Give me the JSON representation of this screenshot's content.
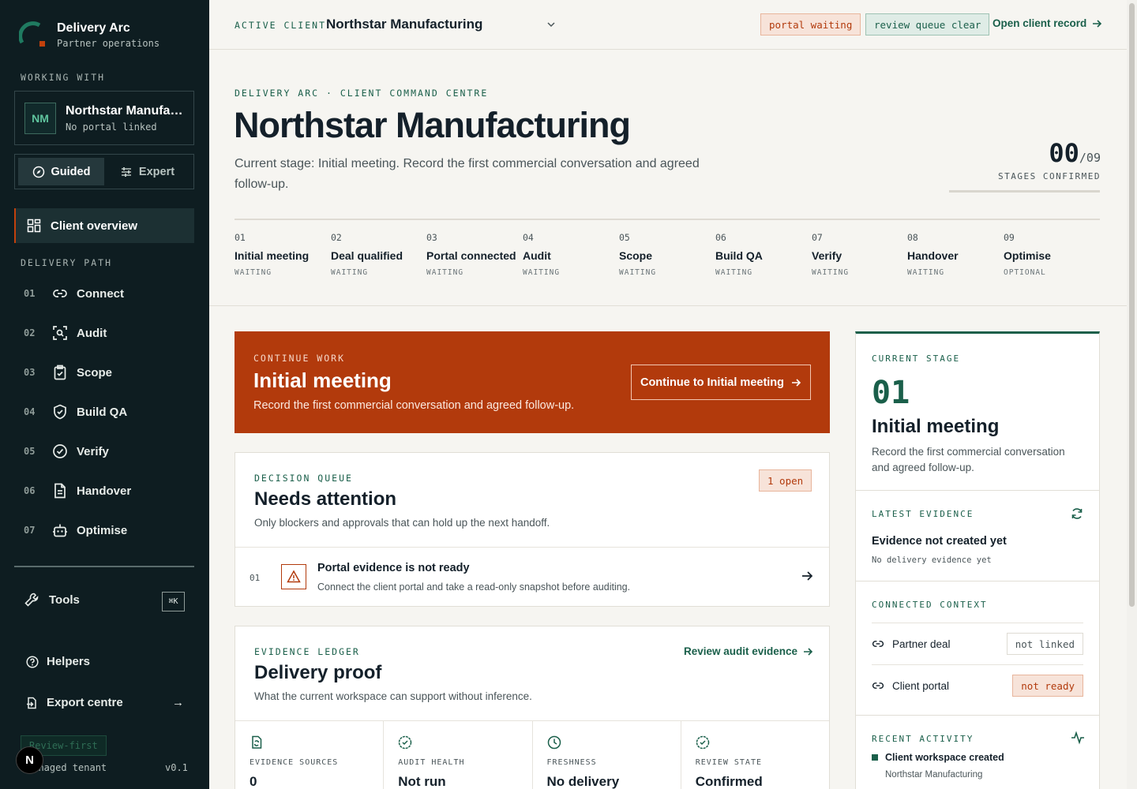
{
  "brand": {
    "name": "Delivery Arc",
    "subtitle": "Partner operations"
  },
  "sidebar": {
    "working_with_label": "WORKING WITH",
    "client": {
      "initials": "NM",
      "name": "Northstar Manufacturing",
      "status": "No portal linked"
    },
    "modes": [
      {
        "label": "Guided",
        "active": true
      },
      {
        "label": "Expert",
        "active": false
      }
    ],
    "overview": "Client overview",
    "delivery_path_label": "DELIVERY PATH",
    "nav": [
      {
        "num": "01",
        "label": "Connect",
        "icon": "link-icon"
      },
      {
        "num": "02",
        "label": "Audit",
        "icon": "scan-icon"
      },
      {
        "num": "03",
        "label": "Scope",
        "icon": "clipboard-icon"
      },
      {
        "num": "04",
        "label": "Build QA",
        "icon": "shield-icon"
      },
      {
        "num": "05",
        "label": "Verify",
        "icon": "check-circle-icon"
      },
      {
        "num": "06",
        "label": "Handover",
        "icon": "document-icon"
      },
      {
        "num": "07",
        "label": "Optimise",
        "icon": "bot-icon"
      }
    ],
    "tools": "Tools",
    "shortcut": "⌘K",
    "helpers": "Helpers",
    "export": "Export centre",
    "review_badge": "Review-first",
    "tenant": "Managed tenant",
    "version": "v0.1"
  },
  "topbar": {
    "label": "ACTIVE CLIENT",
    "client": "Northstar Manufacturing",
    "chip_portal": "portal waiting",
    "chip_review": "review queue clear",
    "link": "Open client record"
  },
  "hero": {
    "eyebrow": "DELIVERY ARC · CLIENT COMMAND CENTRE",
    "title": "Northstar Manufacturing",
    "desc": "Current stage: Initial meeting. Record the first commercial conversation and agreed follow-up.",
    "counter": "00",
    "counter_of": "/09",
    "counter_label": "STAGES CONFIRMED",
    "progress": 0
  },
  "stages": [
    {
      "num": "01",
      "name": "Initial meeting",
      "state": "WAITING"
    },
    {
      "num": "02",
      "name": "Deal qualified",
      "state": "WAITING"
    },
    {
      "num": "03",
      "name": "Portal connected",
      "state": "WAITING"
    },
    {
      "num": "04",
      "name": "Audit",
      "state": "WAITING"
    },
    {
      "num": "05",
      "name": "Scope",
      "state": "WAITING"
    },
    {
      "num": "06",
      "name": "Build QA",
      "state": "WAITING"
    },
    {
      "num": "07",
      "name": "Verify",
      "state": "WAITING"
    },
    {
      "num": "08",
      "name": "Handover",
      "state": "WAITING"
    },
    {
      "num": "09",
      "name": "Optimise",
      "state": "OPTIONAL"
    }
  ],
  "cta": {
    "eyebrow": "CONTINUE WORK",
    "title": "Initial meeting",
    "desc": "Record the first commercial conversation and agreed follow-up.",
    "button": "Continue to Initial meeting"
  },
  "decision_queue": {
    "eyebrow": "DECISION QUEUE",
    "title": "Needs attention",
    "desc": "Only blockers and approvals that can hold up the next handoff.",
    "open_chip": "1 open",
    "items": [
      {
        "num": "01",
        "title": "Portal evidence is not ready",
        "desc": "Connect the client portal and take a read-only snapshot before auditing."
      }
    ]
  },
  "evidence": {
    "eyebrow": "EVIDENCE LEDGER",
    "title": "Delivery proof",
    "desc": "What the current workspace can support without inference.",
    "link": "Review audit evidence",
    "cells": [
      {
        "label": "EVIDENCE SOURCES",
        "value": "0"
      },
      {
        "label": "AUDIT HEALTH",
        "value": "Not run"
      },
      {
        "label": "FRESHNESS",
        "value": "No delivery"
      },
      {
        "label": "REVIEW STATE",
        "value": "Confirmed"
      }
    ]
  },
  "right_panel": {
    "stage_eyebrow": "CURRENT STAGE",
    "stage_num": "01",
    "stage_title": "Initial meeting",
    "stage_desc": "Record the first commercial conversation and agreed follow-up.",
    "evidence_eyebrow": "LATEST EVIDENCE",
    "evidence_title": "Evidence not created yet",
    "evidence_sub": "No delivery evidence yet",
    "context_eyebrow": "CONNECTED CONTEXT",
    "context": [
      {
        "label": "Partner deal",
        "status": "not linked"
      },
      {
        "label": "Client portal",
        "status": "not ready"
      }
    ],
    "activity_eyebrow": "RECENT ACTIVITY",
    "activity_title": "Client workspace created",
    "activity_sub": "Northstar Manufacturing"
  },
  "colors": {
    "accent": "#b23a0c",
    "brand_green": "#1a5f4a",
    "sidebar": "#0e1d21"
  }
}
